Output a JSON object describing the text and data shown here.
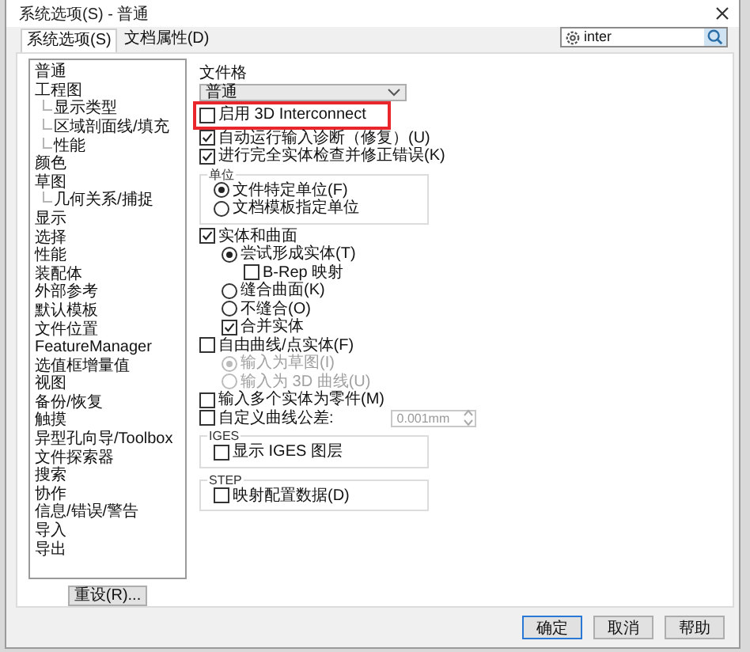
{
  "window": {
    "title": "系统选项(S) - 普通"
  },
  "tabs": [
    {
      "label": "系统选项(S)",
      "selected": true
    },
    {
      "label": "文档属性(D)",
      "selected": false
    }
  ],
  "search": {
    "value": "inter"
  },
  "sidebar": {
    "items": [
      {
        "label": "普通"
      },
      {
        "label": "工程图",
        "children": [
          {
            "label": "显示类型"
          },
          {
            "label": "区域剖面线/填充"
          },
          {
            "label": "性能"
          }
        ]
      },
      {
        "label": "颜色"
      },
      {
        "label": "草图",
        "children": [
          {
            "label": "几何关系/捕捉"
          }
        ]
      },
      {
        "label": "显示"
      },
      {
        "label": "选择"
      },
      {
        "label": "性能"
      },
      {
        "label": "装配体"
      },
      {
        "label": "外部参考"
      },
      {
        "label": "默认模板"
      },
      {
        "label": "文件位置"
      },
      {
        "label": "FeatureManager"
      },
      {
        "label": "选值框增量值"
      },
      {
        "label": "视图"
      },
      {
        "label": "备份/恢复"
      },
      {
        "label": "触摸"
      },
      {
        "label": "异型孔向导/Toolbox"
      },
      {
        "label": "文件探索器"
      },
      {
        "label": "搜索"
      },
      {
        "label": "协作"
      },
      {
        "label": "信息/错误/警告"
      },
      {
        "label": "导入"
      },
      {
        "label": "导出"
      }
    ]
  },
  "reset_button": "重设(R)...",
  "file_format": {
    "label": "文件格",
    "value": "普通"
  },
  "options": [
    {
      "kind": "checkbox",
      "label": "启用 3D Interconnect",
      "checked": false,
      "highlighted": true
    },
    {
      "kind": "checkbox",
      "label": "自动运行输入诊断（修复）(U)",
      "checked": true,
      "highlighted": false
    },
    {
      "kind": "checkbox",
      "label": "进行完全实体检查并修正错误(K)",
      "checked": true,
      "highlighted": false
    },
    {
      "kind": "group",
      "title": "单位",
      "children": [
        {
          "kind": "radio",
          "label": "文件特定单位(F)",
          "selected": true,
          "disabled": false
        },
        {
          "kind": "radio",
          "label": "文档模板指定单位",
          "selected": false,
          "disabled": false
        }
      ]
    },
    {
      "kind": "checkbox",
      "label": "实体和曲面",
      "checked": true,
      "highlighted": false,
      "children": [
        {
          "kind": "radio",
          "label": "尝试形成实体(T)",
          "selected": true,
          "disabled": false,
          "children": [
            {
              "kind": "checkbox",
              "label": "B-Rep 映射",
              "checked": false
            }
          ]
        },
        {
          "kind": "radio",
          "label": "缝合曲面(K)",
          "selected": false,
          "disabled": false
        },
        {
          "kind": "radio",
          "label": "不缝合(O)",
          "selected": false,
          "disabled": false
        },
        {
          "kind": "checkbox",
          "label": "合并实体",
          "checked": true
        }
      ]
    },
    {
      "kind": "checkbox",
      "label": "自由曲线/点实体(F)",
      "checked": false,
      "highlighted": false,
      "children": [
        {
          "kind": "radio",
          "label": "输入为草图(I)",
          "selected": true,
          "disabled": true
        },
        {
          "kind": "radio",
          "label": "输入为 3D 曲线(U)",
          "selected": false,
          "disabled": true
        }
      ]
    },
    {
      "kind": "checkbox",
      "label": "输入多个实体为零件(M)",
      "checked": false,
      "highlighted": false
    },
    {
      "kind": "checkbox",
      "label": "自定义曲线公差:",
      "checked": false,
      "highlighted": false,
      "field": {
        "value": "0.001mm",
        "disabled": true
      }
    },
    {
      "kind": "group",
      "title": "IGES",
      "children": [
        {
          "kind": "checkbox",
          "label": "显示 IGES 图层",
          "checked": false
        }
      ]
    },
    {
      "kind": "group",
      "title": "STEP",
      "children": [
        {
          "kind": "checkbox",
          "label": "映射配置数据(D)",
          "checked": false
        }
      ]
    }
  ],
  "buttons": [
    "确定",
    "取消",
    "帮助"
  ]
}
